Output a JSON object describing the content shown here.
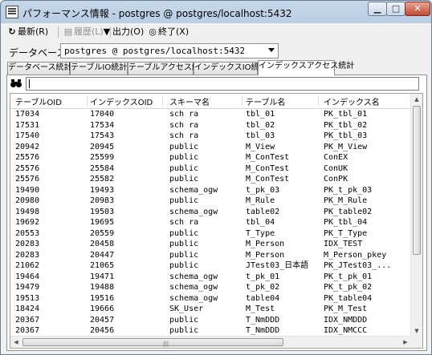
{
  "window": {
    "title": "パフォーマンス情報 - postgres @ postgres/localhost:5432",
    "min_label": "▁",
    "max_label": "□",
    "close_label": "✕"
  },
  "toolbar": {
    "refresh_label": "最新(R)",
    "history_label": "履歴(L)",
    "output_label": "出力(O)",
    "exit_label": "終了(X)"
  },
  "database": {
    "label": "データベース",
    "selected": "postgres @ postgres/localhost:5432"
  },
  "tabs": [
    {
      "label": "データベース統計"
    },
    {
      "label": "テーブルIO統計"
    },
    {
      "label": "テーブルアクセス統計"
    },
    {
      "label": "インデックスIO統計"
    },
    {
      "label": "インデックスアクセス統計"
    }
  ],
  "active_tab": "インデックスアクセス統計",
  "search": {
    "value": ""
  },
  "table": {
    "columns": [
      "テーブルOID",
      "インデックスOID",
      "スキーマ名",
      "テーブル名",
      "インデックス名"
    ],
    "rows": [
      [
        "17034",
        "17040",
        "sch ra",
        "tbl_01",
        "PK_tbl_01"
      ],
      [
        "17531",
        "17534",
        "sch ra",
        "tbl_02",
        "PK_tbl_02"
      ],
      [
        "17540",
        "17543",
        "sch ra",
        "tbl_03",
        "PK_tbl_03"
      ],
      [
        "20942",
        "20945",
        "public",
        "M_View",
        "PK_M_View"
      ],
      [
        "25576",
        "25599",
        "public",
        "M_ConTest",
        "ConEX"
      ],
      [
        "25576",
        "25584",
        "public",
        "M_ConTest",
        "ConUK"
      ],
      [
        "25576",
        "25582",
        "public",
        "M_ConTest",
        "ConPK"
      ],
      [
        "19490",
        "19493",
        "schema_ogw",
        "t_pk_03",
        "PK_t_pk_03"
      ],
      [
        "20980",
        "20983",
        "public",
        "M_Rule",
        "PK_M_Rule"
      ],
      [
        "19498",
        "19503",
        "schema_ogw",
        "table02",
        "PK_table02"
      ],
      [
        "19692",
        "19695",
        "sch ra",
        "tbl_04",
        "PK_tbl_04"
      ],
      [
        "20553",
        "20559",
        "public",
        "T_Type",
        "PK_T_Type"
      ],
      [
        "20283",
        "20458",
        "public",
        "M_Person",
        "IDX_TEST"
      ],
      [
        "20283",
        "20447",
        "public",
        "M_Person",
        "M_Person_pkey"
      ],
      [
        "21062",
        "21065",
        "public",
        "JTest03_日本語",
        "PK_JTest03_..."
      ],
      [
        "19464",
        "19471",
        "schema_ogw",
        "t_pk_01",
        "PK_t_pk_01"
      ],
      [
        "19479",
        "19488",
        "schema_ogw",
        "t_pk_02",
        "PK_t_pk_02"
      ],
      [
        "19513",
        "19516",
        "schema_ogw",
        "table04",
        "PK_table04"
      ],
      [
        "18424",
        "19666",
        "SK_User",
        "M_Test",
        "PK_M_Test"
      ],
      [
        "20367",
        "20457",
        "public",
        "T_NmDDD",
        "IDX_NMDDD"
      ],
      [
        "20367",
        "20456",
        "public",
        "T_NmDDD",
        "IDX_NMCCC"
      ]
    ]
  },
  "scroll": {
    "up_glyph": "▲",
    "down_glyph": "▼",
    "left_glyph": "◀",
    "right_glyph": "▶",
    "grip_glyph": "|||"
  }
}
